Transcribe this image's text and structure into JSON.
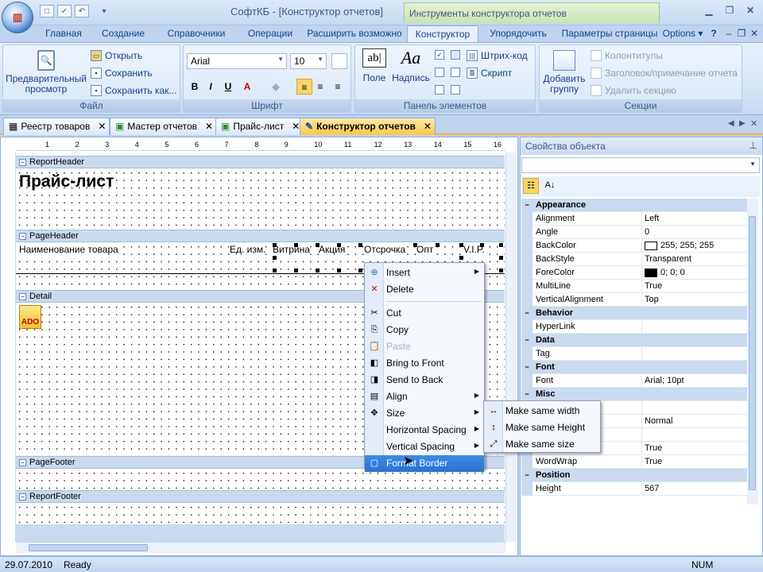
{
  "window": {
    "title": "СофтКБ - [Конструктор отчетов]",
    "context_tab_header": "Инструменты конструктора отчетов",
    "options": "Options",
    "help": "?"
  },
  "ribbon_tabs": [
    "Главная",
    "Создание",
    "Справочники",
    "Операции",
    "Расширить возможно",
    "Конструктор",
    "Упорядочить",
    "Параметры страницы"
  ],
  "ribbon": {
    "file": {
      "label": "Файл",
      "preview": "Предварительный просмотр",
      "open": "Открыть",
      "save": "Сохранить",
      "save_as": "Сохранить как..."
    },
    "font": {
      "label": "Шрифт",
      "family": "Arial",
      "size": "10"
    },
    "elements": {
      "label": "Панель элементов",
      "field": "Поле",
      "caption": "Надпись",
      "barcode": "Штрих-код",
      "script": "Скрипт"
    },
    "sections": {
      "label": "Секции",
      "add_group": "Добавить группу",
      "page_headers": "Колонтитулы",
      "header_note": "Заголовок/примечание отчета",
      "delete_section": "Удалить секцию"
    }
  },
  "doc_tabs": [
    "Реестр товаров",
    "Мастер отчетов",
    "Прайс-лист",
    "Конструктор отчетов"
  ],
  "designer": {
    "ruler_numbers": [
      "1",
      "2",
      "3",
      "4",
      "5",
      "6",
      "7",
      "8",
      "9",
      "10",
      "11",
      "12",
      "13",
      "14",
      "15",
      "16"
    ],
    "bands": {
      "report_header": "ReportHeader",
      "page_header": "PageHeader",
      "detail": "Detail",
      "page_footer": "PageFooter",
      "report_footer": "ReportFooter"
    },
    "report_title": "Прайс-лист",
    "columns": [
      "Наименование товара",
      "Ед. изм.",
      "Витрина",
      "Акция",
      "Отсрочка",
      "Опт",
      "V.I.P."
    ],
    "ado_label": "ADO"
  },
  "properties": {
    "title": "Свойства объекта",
    "rows": [
      {
        "type": "cat",
        "name": "Appearance"
      },
      {
        "name": "Alignment",
        "value": "Left"
      },
      {
        "name": "Angle",
        "value": "0"
      },
      {
        "name": "BackColor",
        "value": "255; 255; 255",
        "swatch": "#ffffff"
      },
      {
        "name": "BackStyle",
        "value": "Transparent"
      },
      {
        "name": "ForeColor",
        "value": "0; 0; 0",
        "swatch": "#000000"
      },
      {
        "name": "MultiLine",
        "value": "True"
      },
      {
        "name": "VerticalAlignment",
        "value": "Top"
      },
      {
        "type": "cat",
        "name": "Behavior"
      },
      {
        "name": "HyperLink",
        "value": ""
      },
      {
        "type": "cat",
        "name": "Data"
      },
      {
        "name": "Tag",
        "value": ""
      },
      {
        "type": "cat",
        "name": "Font"
      },
      {
        "name": "Font",
        "value": "Arial; 10pt"
      },
      {
        "type": "cat",
        "name": "Misc"
      },
      {
        "name": "",
        "value": ""
      },
      {
        "name": "",
        "value": "Normal"
      },
      {
        "name": "",
        "value": ""
      },
      {
        "name": "Visible",
        "value": "True"
      },
      {
        "name": "WordWrap",
        "value": "True"
      },
      {
        "type": "cat",
        "name": "Position"
      },
      {
        "name": "Height",
        "value": "567"
      }
    ]
  },
  "context_menu": {
    "items": [
      {
        "label": "Insert",
        "icon": "insert-icon",
        "sub": true
      },
      {
        "label": "Delete",
        "icon": "delete-icon"
      },
      {
        "sep": true
      },
      {
        "label": "Cut",
        "icon": "cut-icon"
      },
      {
        "label": "Copy",
        "icon": "copy-icon"
      },
      {
        "label": "Paste",
        "icon": "paste-icon",
        "disabled": true
      },
      {
        "label": "Bring to Front",
        "icon": "bring-front-icon"
      },
      {
        "label": "Send to Back",
        "icon": "send-back-icon"
      },
      {
        "label": "Align",
        "icon": "align-icon",
        "sub": true
      },
      {
        "label": "Size",
        "icon": "size-icon",
        "sub": true
      },
      {
        "label": "Horizontal Spacing",
        "sub": true
      },
      {
        "label": "Vertical Spacing",
        "sub": true
      },
      {
        "label": "Format Border",
        "icon": "border-icon",
        "highlight": true
      }
    ],
    "submenu": [
      "Make same width",
      "Make same Height",
      "Make same size"
    ]
  },
  "status": {
    "date": "29.07.2010",
    "state": "Ready",
    "num": "NUM"
  }
}
